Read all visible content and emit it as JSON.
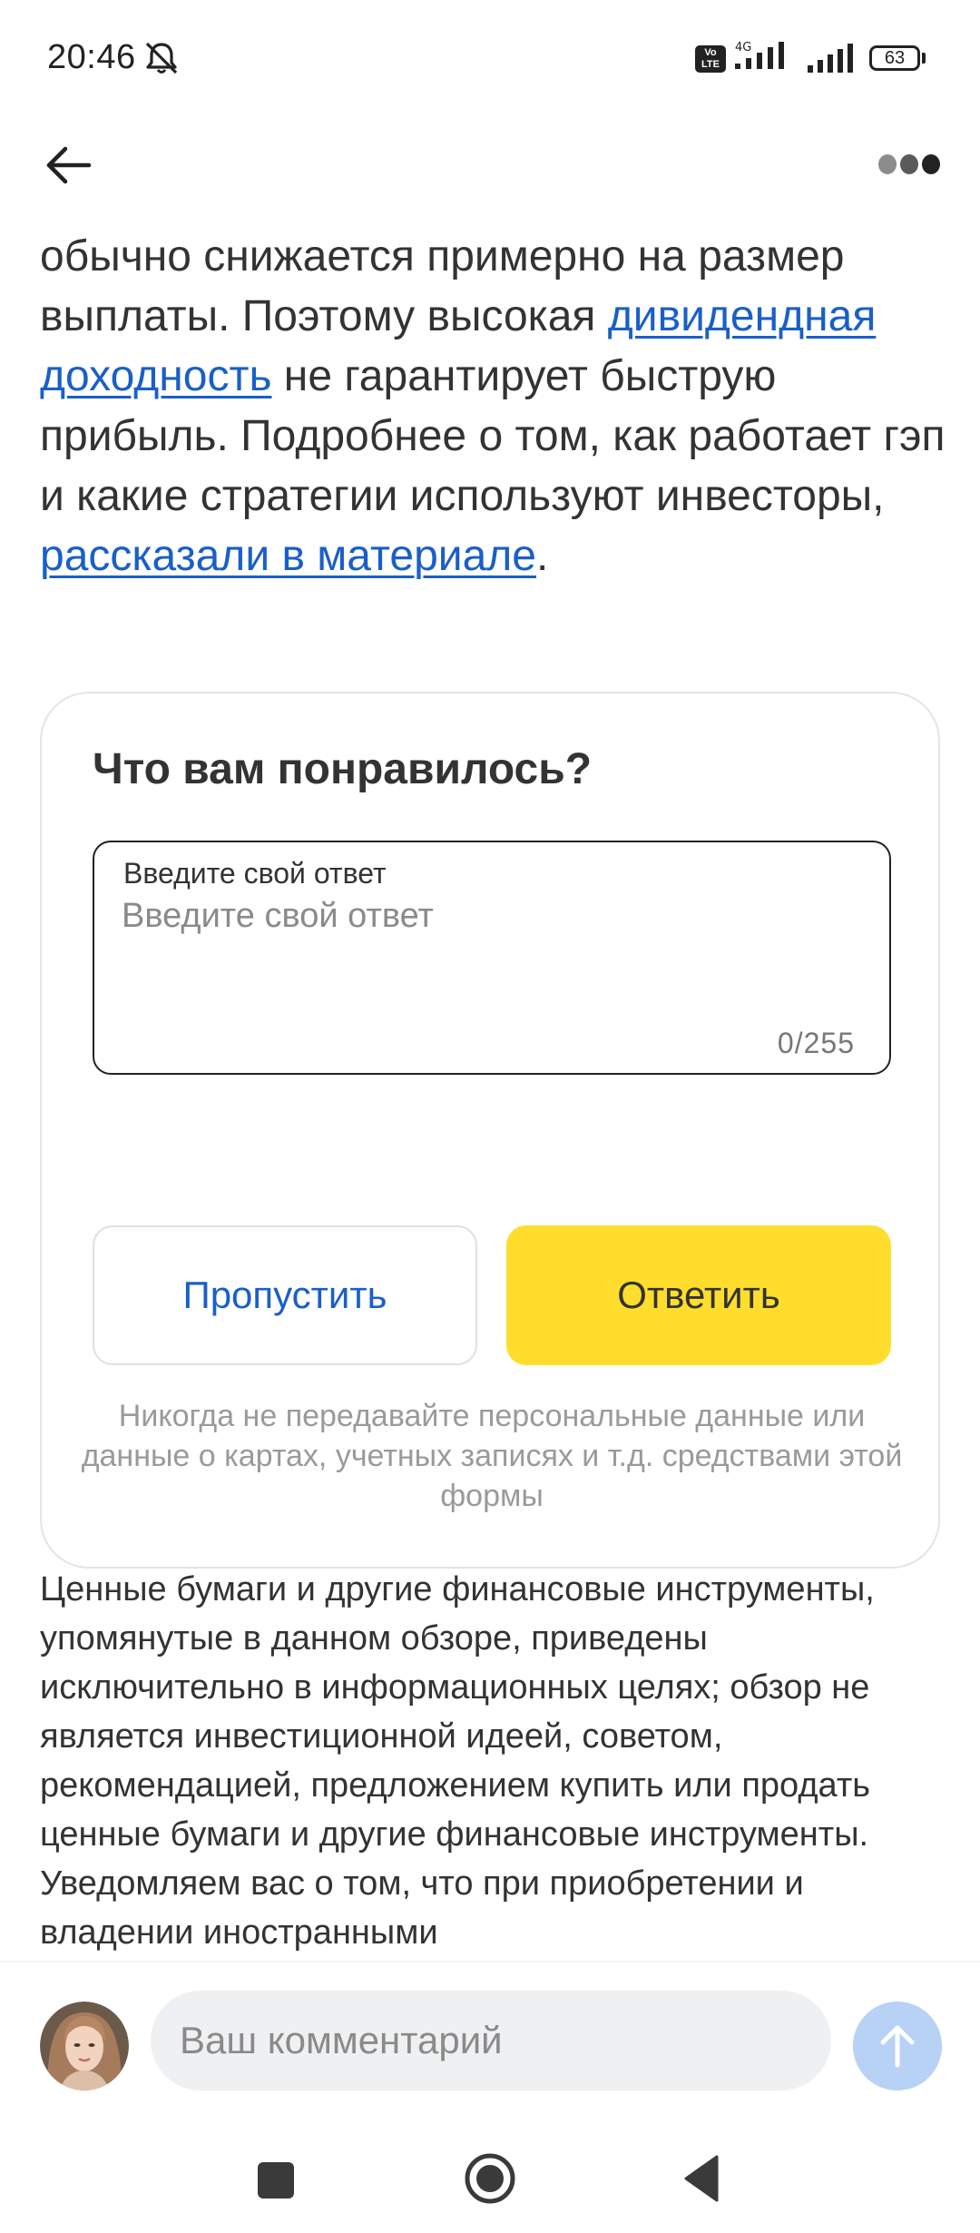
{
  "status_bar": {
    "time": "20:46",
    "network_type": "4G",
    "volte_label": "Vo LTE",
    "battery_level": "63"
  },
  "top_nav": {
    "back_icon": "arrow-left-icon",
    "more_icon": "more-dots-icon"
  },
  "article": {
    "text_1": "обычно снижается примерно на размер выплаты. Поэтому высокая ",
    "link_dividend": "дивидендная доходность",
    "text_2": " не гарантирует быструю прибыль. Подробнее о том, как работает гэп и какие стратегии используют инвесторы, ",
    "link_material": "рассказали в материале",
    "text_3": ".",
    "link_color": "#1a5fc8"
  },
  "feedback": {
    "title": "Что вам понравилось?",
    "field_label": "Введите свой ответ",
    "field_placeholder": "Введите свой ответ",
    "field_value": "",
    "counter": "0/255",
    "skip_label": "Пропустить",
    "submit_label": "Ответить",
    "submit_color": "#ffdd2d",
    "privacy_note": "Никогда не передавайте персональные данные или данные о картах, учетных записях и т.д. средствами этой формы"
  },
  "disclaimer": {
    "text": "Ценные бумаги и другие финансовые инструменты, упомянутые в данном обзоре, приведены исключительно в информационных целях; обзор не является инвестиционной идеей, советом, рекомендацией, предложением купить или продать ценные бумаги и другие финансовые инструменты. Уведомляем вас о том, что при приобретении и владении иностранными"
  },
  "comment_bar": {
    "placeholder": "Ваш комментарий",
    "avatar_icon": "user-avatar",
    "send_icon": "arrow-up-icon"
  },
  "nav_bar": {
    "recents_icon": "square-icon",
    "home_icon": "circle-icon",
    "back_icon": "triangle-back-icon"
  }
}
